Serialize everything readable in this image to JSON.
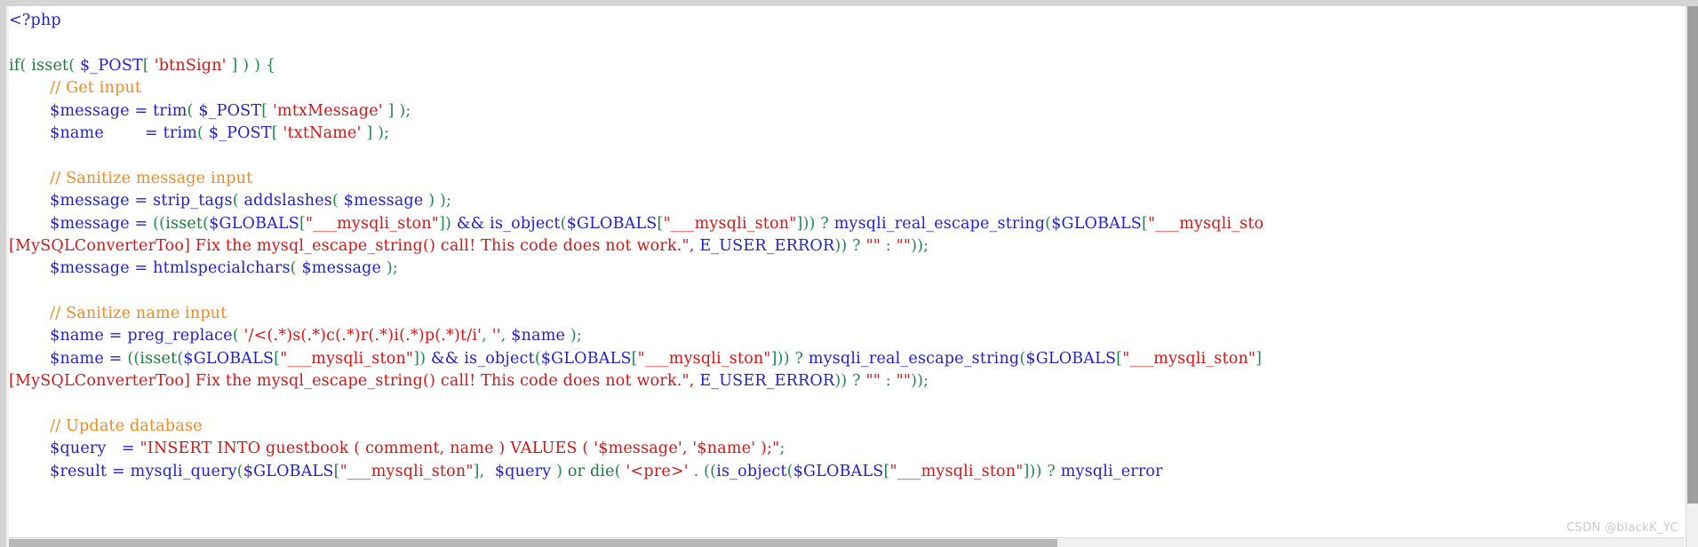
{
  "document": {
    "type": "code-listing",
    "language": "php",
    "font": "serif-monospace",
    "background": "#ffffff"
  },
  "colors": {
    "keyword": "#1f7a3d",
    "variable": "#2222cc",
    "function": "#2222cc",
    "string": "#d41616",
    "comment": "#f08a24",
    "punctuation": "#1f8a4d",
    "frame": "#d4d4d4",
    "scrollbar_thumb": "#9e9e9e",
    "watermark": "#c9c9c9"
  },
  "watermark": {
    "text": "CSDN @blackK_YC"
  },
  "code": {
    "lines": [
      {
        "index": 1,
        "text": "<?php",
        "tokens": [
          {
            "t": "<?php",
            "c": "tok-tag"
          }
        ]
      },
      {
        "index": 2,
        "text": "",
        "tokens": []
      },
      {
        "index": 3,
        "text": "if( isset( $_POST[ 'btnSign' ] ) ) {",
        "tokens": [
          {
            "t": "if",
            "c": "tok-kw"
          },
          {
            "t": "(",
            "c": "tok-punc"
          },
          {
            "t": "  isset",
            "c": "tok-kw"
          },
          {
            "t": "(",
            "c": "tok-punc"
          },
          {
            "t": "  $_POST",
            "c": "tok-var"
          },
          {
            "t": "[",
            "c": "tok-punc"
          },
          {
            "t": "  'btnSign'",
            "c": "tok-str"
          },
          {
            "t": "  ]  )  )  {",
            "c": "tok-punc"
          }
        ]
      },
      {
        "index": 4,
        "text": "        // Get input",
        "tokens": [
          {
            "t": "        // Get  input",
            "c": "tok-cmt"
          }
        ]
      },
      {
        "index": 5,
        "text": "        $message = trim( $_POST[ 'mtxMessage' ] );",
        "tokens": [
          {
            "t": "        $message",
            "c": "tok-var"
          },
          {
            "t": "  =  ",
            "c": "tok-op"
          },
          {
            "t": "trim",
            "c": "tok-fn"
          },
          {
            "t": "(",
            "c": "tok-punc"
          },
          {
            "t": "  $_POST",
            "c": "tok-var"
          },
          {
            "t": "[",
            "c": "tok-punc"
          },
          {
            "t": "  'mtxMessage'",
            "c": "tok-str"
          },
          {
            "t": "  ]  );",
            "c": "tok-punc"
          }
        ]
      },
      {
        "index": 6,
        "text": "        $name        = trim( $_POST[ 'txtName' ] );",
        "tokens": [
          {
            "t": "        $name",
            "c": "tok-var"
          },
          {
            "t": "        =  ",
            "c": "tok-op"
          },
          {
            "t": "trim",
            "c": "tok-fn"
          },
          {
            "t": "(",
            "c": "tok-punc"
          },
          {
            "t": "  $_POST",
            "c": "tok-var"
          },
          {
            "t": "[",
            "c": "tok-punc"
          },
          {
            "t": "  'txtName'",
            "c": "tok-str"
          },
          {
            "t": "  ]  );",
            "c": "tok-punc"
          }
        ]
      },
      {
        "index": 7,
        "text": "",
        "tokens": []
      },
      {
        "index": 8,
        "text": "        // Sanitize message input",
        "tokens": [
          {
            "t": "        // Sanitize  message  input",
            "c": "tok-cmt"
          }
        ]
      },
      {
        "index": 9,
        "text": "        $message = strip_tags( addslashes( $message ) );",
        "tokens": [
          {
            "t": "        $message",
            "c": "tok-var"
          },
          {
            "t": "  =  ",
            "c": "tok-op"
          },
          {
            "t": "strip_tags",
            "c": "tok-fn"
          },
          {
            "t": "(",
            "c": "tok-punc"
          },
          {
            "t": "  addslashes",
            "c": "tok-fn"
          },
          {
            "t": "(",
            "c": "tok-punc"
          },
          {
            "t": "  $message",
            "c": "tok-var"
          },
          {
            "t": "  )  );",
            "c": "tok-punc"
          }
        ]
      },
      {
        "index": 10,
        "text": "        $message = ((isset($GLOBALS[\"___mysqli_ston\"]) && is_object($GLOBALS[\"___mysqli_ston\"])) ? mysqli_real_escape_string($GLOBALS[\"___mysqli_sto",
        "wrapped": true,
        "tokens": []
      },
      {
        "index": 11,
        "text": "[MySQLConverterToo] Fix the mysql_escape_string() call! This code does not work.\", E_USER_ERROR)) ? \"\" : \"\"));",
        "continuation": true,
        "tokens": []
      },
      {
        "index": 12,
        "text": "        $message = htmlspecialchars( $message );",
        "tokens": [
          {
            "t": "        $message",
            "c": "tok-var"
          },
          {
            "t": "  =  ",
            "c": "tok-op"
          },
          {
            "t": "htmlspecialchars",
            "c": "tok-fn"
          },
          {
            "t": "(",
            "c": "tok-punc"
          },
          {
            "t": "  $message",
            "c": "tok-var"
          },
          {
            "t": "  );",
            "c": "tok-punc"
          }
        ]
      },
      {
        "index": 13,
        "text": "",
        "tokens": []
      },
      {
        "index": 14,
        "text": "        // Sanitize name input",
        "tokens": [
          {
            "t": "        // Sanitize  name  input",
            "c": "tok-cmt"
          }
        ]
      },
      {
        "index": 15,
        "text": "        $name = preg_replace( '/<(.*)s(.*)c(.*)r(.*)i(.*)p(.*)t/i', '', $name );",
        "tokens": []
      },
      {
        "index": 16,
        "text": "        $name = ((isset($GLOBALS[\"___mysqli_ston\"]) && is_object($GLOBALS[\"___mysqli_ston\"])) ? mysqli_real_escape_string($GLOBALS[\"___mysqli_ston\"]",
        "wrapped": true,
        "tokens": []
      },
      {
        "index": 17,
        "text": "[MySQLConverterToo] Fix the mysql_escape_string() call! This code does not work.\", E_USER_ERROR)) ? \"\" : \"\"));",
        "continuation": true,
        "tokens": []
      },
      {
        "index": 18,
        "text": "",
        "tokens": []
      },
      {
        "index": 19,
        "text": "        // Update database",
        "tokens": [
          {
            "t": "        // Update  database",
            "c": "tok-cmt"
          }
        ]
      },
      {
        "index": 20,
        "text": "        $query   = \"INSERT INTO guestbook ( comment, name ) VALUES ( '$message', '$name' );\";",
        "tokens": []
      },
      {
        "index": 21,
        "text": "        $result = mysqli_query($GLOBALS[\"___mysqli_ston\"],  $query ) or die( '<pre>' . ((is_object($GLOBALS[\"___mysqli_ston\"])) ? mysqli_error",
        "wrapped": true,
        "tokens": []
      }
    ]
  }
}
